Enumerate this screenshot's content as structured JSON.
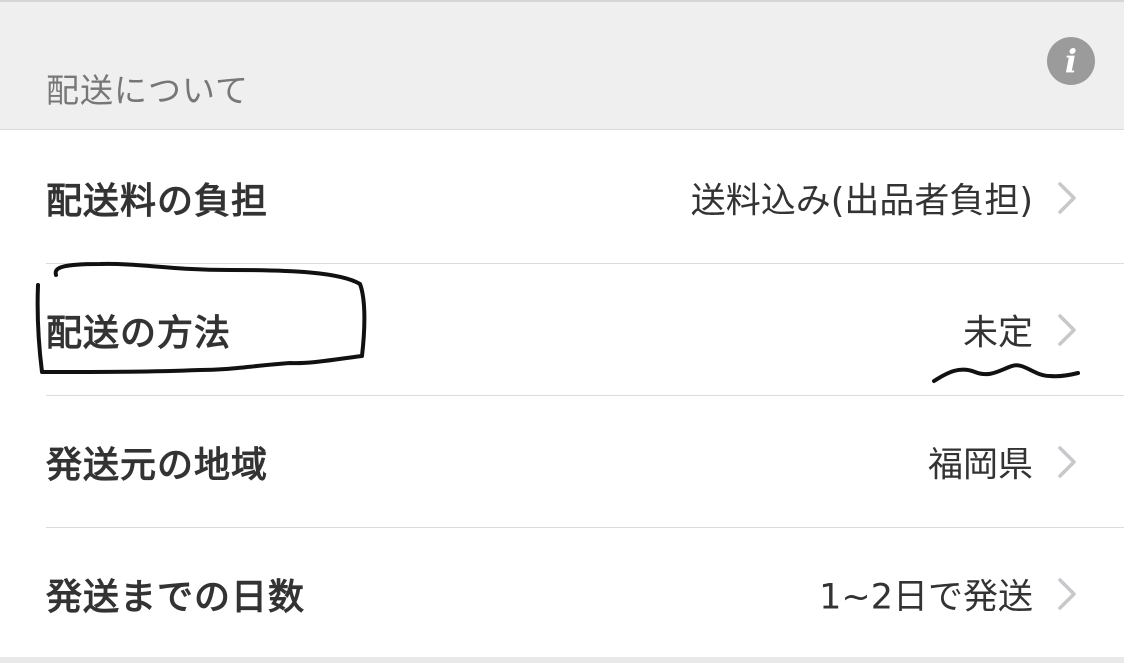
{
  "section": {
    "title": "配送について",
    "info_icon": "info-icon"
  },
  "rows": [
    {
      "label": "配送料の負担",
      "value": "送料込み(出品者負担)",
      "icon": "chevron-right-icon"
    },
    {
      "label": "配送の方法",
      "value": "未定",
      "icon": "chevron-right-icon"
    },
    {
      "label": "発送元の地域",
      "value": "福岡県",
      "icon": "chevron-right-icon"
    },
    {
      "label": "発送までの日数",
      "value": "1~2日で発送",
      "icon": "chevron-right-icon"
    }
  ],
  "colors": {
    "header_bg": "#efefef",
    "label": "#333333",
    "muted": "#777777",
    "chevron": "#c7c7cc",
    "annotation_ink": "#111111"
  }
}
